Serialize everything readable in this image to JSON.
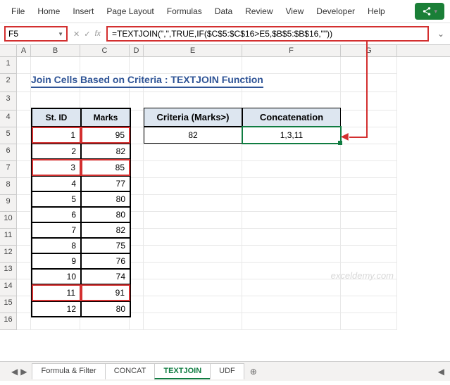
{
  "ribbon": {
    "items": [
      "File",
      "Home",
      "Insert",
      "Page Layout",
      "Formulas",
      "Data",
      "Review",
      "View",
      "Developer",
      "Help"
    ]
  },
  "namebox": "F5",
  "formula": "=TEXTJOIN(\",\",TRUE,IF($C$5:$C$16>E5,$B$5:$B$16,\"\"))",
  "columns": [
    "A",
    "B",
    "C",
    "D",
    "E",
    "F",
    "G"
  ],
  "row_nums": [
    "1",
    "2",
    "3",
    "4",
    "5",
    "6",
    "7",
    "8",
    "9",
    "10",
    "11",
    "12",
    "13",
    "14",
    "15",
    "16"
  ],
  "title": "Join Cells Based on Criteria : TEXTJOIN Function",
  "table": {
    "h1": "St. ID",
    "h2": "Marks",
    "rows": [
      {
        "id": "1",
        "m": "95",
        "hl": true
      },
      {
        "id": "2",
        "m": "82",
        "hl": false
      },
      {
        "id": "3",
        "m": "85",
        "hl": true
      },
      {
        "id": "4",
        "m": "77",
        "hl": false
      },
      {
        "id": "5",
        "m": "80",
        "hl": false
      },
      {
        "id": "6",
        "m": "80",
        "hl": false
      },
      {
        "id": "7",
        "m": "82",
        "hl": false
      },
      {
        "id": "8",
        "m": "75",
        "hl": false
      },
      {
        "id": "9",
        "m": "76",
        "hl": false
      },
      {
        "id": "10",
        "m": "74",
        "hl": false
      },
      {
        "id": "11",
        "m": "91",
        "hl": true
      },
      {
        "id": "12",
        "m": "80",
        "hl": false
      }
    ]
  },
  "criteria": {
    "h1": "Criteria (Marks>)",
    "h2": "Concatenation",
    "val": "82",
    "result": "1,3,11"
  },
  "tabs": [
    "Formula & Filter",
    "CONCAT",
    "TEXTJOIN",
    "UDF"
  ],
  "active_tab": "TEXTJOIN",
  "watermark": "exceldemy.com"
}
